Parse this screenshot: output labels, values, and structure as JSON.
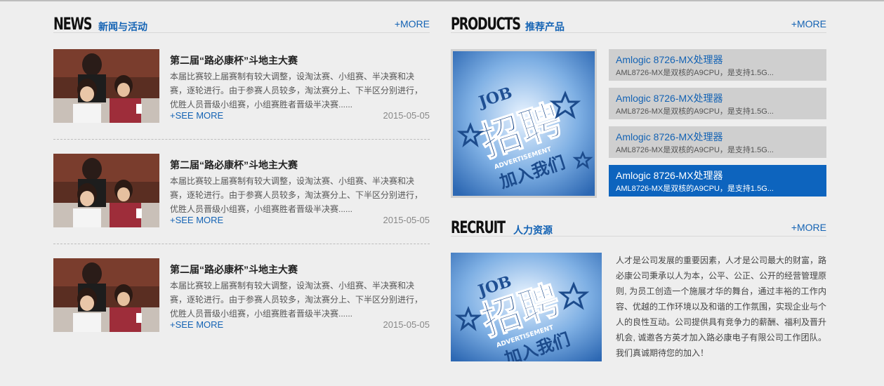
{
  "news": {
    "title": "NEWS",
    "subtitle": "新闻与活动",
    "more": "+MORE",
    "items": [
      {
        "title": "第二届“路必康杯”斗地主大赛",
        "desc": "本届比赛较上届赛制有较大调整，设淘汰赛、小组赛、半决赛和决赛，逐轮进行。由于参赛人员较多，淘汰赛分上、下半区分别进行，优胜人员晋级小组赛，小组赛胜者晋级半决赛......",
        "see_more": "+SEE MORE",
        "date": "2015-05-05"
      },
      {
        "title": "第二届“路必康杯”斗地主大赛",
        "desc": "本届比赛较上届赛制有较大调整，设淘汰赛、小组赛、半决赛和决赛，逐轮进行。由于参赛人员较多，淘汰赛分上、下半区分别进行，优胜人员晋级小组赛，小组赛胜者晋级半决赛......",
        "see_more": "+SEE MORE",
        "date": "2015-05-05"
      },
      {
        "title": "第二届“路必康杯”斗地主大赛",
        "desc": "本届比赛较上届赛制有较大调整，设淘汰赛、小组赛、半决赛和决赛，逐轮进行。由于参赛人员较多，淘汰赛分上、下半区分别进行，优胜人员晋级小组赛，小组赛胜者晋级半决赛......",
        "see_more": "+SEE MORE",
        "date": "2015-05-05"
      }
    ]
  },
  "products": {
    "title": "PRODUCTS",
    "subtitle": "推荐产品",
    "more": "+MORE",
    "image_text": {
      "job": "JOB",
      "big": "招聘",
      "ad": "ADVERTISEMENT",
      "join": "加入我们"
    },
    "items": [
      {
        "name": "Amlogic 8726-MX处理器",
        "desc": "AML8726-MX是双核的A9CPU，是支持1.5G..."
      },
      {
        "name": "Amlogic 8726-MX处理器",
        "desc": "AML8726-MX是双核的A9CPU，是支持1.5G..."
      },
      {
        "name": "Amlogic 8726-MX处理器",
        "desc": "AML8726-MX是双核的A9CPU，是支持1.5G..."
      },
      {
        "name": "Amlogic 8726-MX处理器",
        "desc": "AML8726-MX是双核的A9CPU，是支持1.5G..."
      }
    ]
  },
  "recruit": {
    "title": "RECRUIT",
    "subtitle": "人力资源",
    "more": "+MORE",
    "image_text": {
      "job": "JOB",
      "big": "招聘",
      "ad": "ADVERTISEMENT",
      "join": "加入我们"
    },
    "text": "人才是公司发展的重要因素，人才是公司最大的财富，路必康公司秉承以人为本，公平、公正、公开的经营管理原则, 为员工创造一个施展才华的舞台，通过丰裕的工作内容、优越的工作环境以及和谐的工作氛围，实现企业与个人的良性互动。公司提供具有竞争力的薪酬、福利及晋升机会, 诚邀各方英才加入路必康电子有限公司工作团队。我们真诚期待您的加入！"
  },
  "colors": {
    "accent": "#1463b4",
    "active_item": "#0d64be",
    "background": "#eeeeee"
  }
}
